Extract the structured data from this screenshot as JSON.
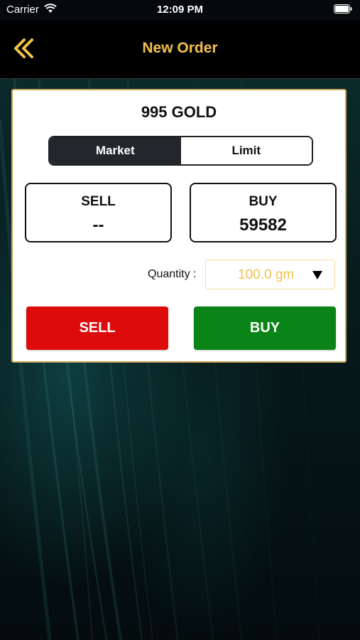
{
  "status_bar": {
    "carrier": "Carrier",
    "time": "12:09 PM",
    "wifi_icon": "wifi-icon",
    "battery_icon": "battery-icon"
  },
  "nav": {
    "title": "New Order",
    "back_icon": "double-chevron-left-icon",
    "accent_color": "#f2c14e"
  },
  "order": {
    "product": "995 GOLD",
    "tabs": [
      {
        "label": "Market",
        "active": true
      },
      {
        "label": "Limit",
        "active": false
      }
    ],
    "sell_price": {
      "label": "SELL",
      "value": "--"
    },
    "buy_price": {
      "label": "BUY",
      "value": "59582"
    },
    "quantity": {
      "label": "Quantity :",
      "value": "100.0 gm",
      "icon": "chevron-down-icon"
    },
    "sell_button": {
      "label": "SELL",
      "color": "#dd0b0b"
    },
    "buy_button": {
      "label": "BUY",
      "color": "#0a8416"
    }
  }
}
